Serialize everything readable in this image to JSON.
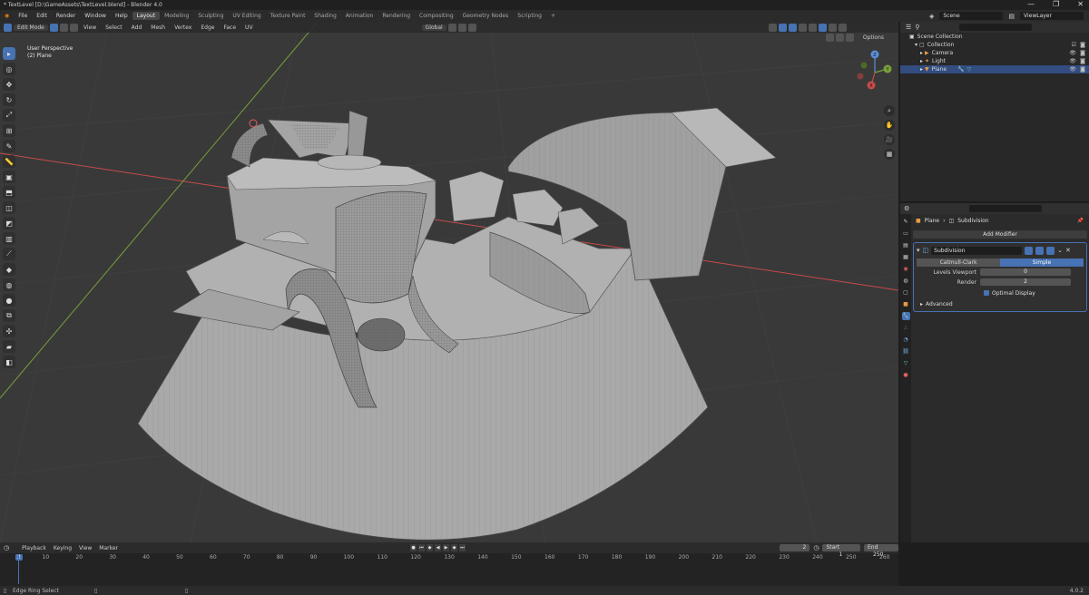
{
  "window": {
    "title": "* TextLevel [D:\\GameAssets\\TextLevel.blend] - Blender 4.0",
    "controls": [
      "—",
      "❐",
      "✕"
    ]
  },
  "menu": {
    "items": [
      "File",
      "Edit",
      "Render",
      "Window",
      "Help"
    ],
    "workspaces": [
      "Layout",
      "Modeling",
      "Sculpting",
      "UV Editing",
      "Texture Paint",
      "Shading",
      "Animation",
      "Rendering",
      "Compositing",
      "Geometry Nodes",
      "Scripting",
      "+"
    ],
    "active_workspace": "Layout",
    "scene": "Scene",
    "view_layer": "ViewLayer"
  },
  "viewport": {
    "mode": "Edit Mode",
    "menus": [
      "View",
      "Select",
      "Add",
      "Mesh",
      "Vertex",
      "Edge",
      "Face",
      "UV"
    ],
    "orientation": "Global",
    "options": "Options",
    "overlay_line1": "User Perspective",
    "overlay_line2": "(2) Plane",
    "gizmo_labels": [
      "Z",
      "Y",
      "X"
    ]
  },
  "outliner": {
    "search_placeholder": "",
    "rows": [
      {
        "label": "Scene Collection"
      },
      {
        "label": "Collection"
      },
      {
        "label": "Camera"
      },
      {
        "label": "Light"
      },
      {
        "label": "Plane"
      }
    ]
  },
  "properties": {
    "breadcrumb_object": "Plane",
    "breadcrumb_modifier": "Subdivision",
    "add_modifier": "Add Modifier",
    "modifier_name": "Subdivision",
    "mode_options": [
      "Catmull-Clark",
      "Simple"
    ],
    "active_mode": "Simple",
    "levels_viewport_label": "Levels Viewport",
    "levels_viewport_value": "0",
    "render_label": "Render",
    "render_value": "2",
    "optimal_display": "Optimal Display",
    "advanced": "Advanced"
  },
  "timeline": {
    "menus": [
      "Playback",
      "Keying",
      "View",
      "Marker"
    ],
    "current_frame": "2",
    "start_label": "Start",
    "start_value": "1",
    "end_label": "End",
    "end_value": "250",
    "ruler": [
      "2",
      "10",
      "20",
      "30",
      "40",
      "50",
      "60",
      "70",
      "80",
      "90",
      "100",
      "110",
      "120",
      "130",
      "140",
      "150",
      "160",
      "170",
      "180",
      "190",
      "200",
      "210",
      "220",
      "230",
      "240",
      "250",
      "260"
    ]
  },
  "status": {
    "hint": "Edge Ring Select",
    "version": "4.0.2"
  },
  "colors": {
    "accent": "#4772b3",
    "viewport_bg": "#393939",
    "mesh_face": "#a7a7a7",
    "x_axis": "#c94a4a",
    "y_axis": "#77a03a"
  }
}
